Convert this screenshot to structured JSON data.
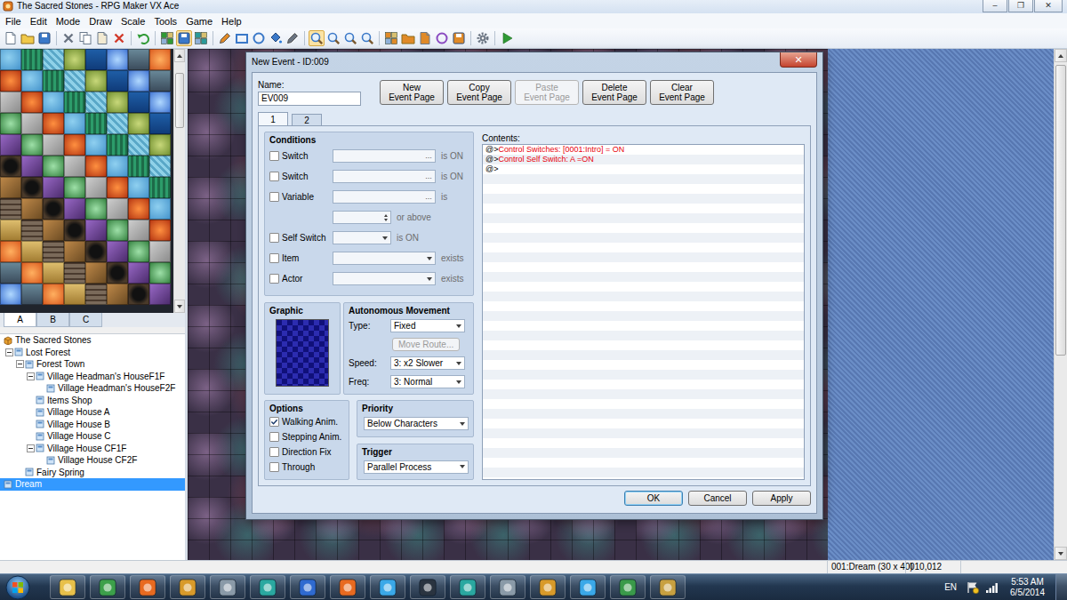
{
  "window": {
    "title": "The Sacred Stones - RPG Maker VX Ace",
    "controls": [
      "–",
      "❐",
      "✕"
    ]
  },
  "menu": [
    "File",
    "Edit",
    "Mode",
    "Draw",
    "Scale",
    "Tools",
    "Game",
    "Help"
  ],
  "toolbar": [
    [
      {
        "selected": false
      },
      {
        "selected": false
      },
      {
        "selected": false
      }
    ],
    [
      {
        "selected": false
      },
      {
        "selected": false
      },
      {
        "selected": false
      },
      {
        "selected": false
      }
    ],
    [
      {
        "selected": false
      }
    ],
    [
      {
        "selected": false
      },
      {
        "selected": true
      },
      {
        "selected": false
      }
    ],
    [
      {
        "selected": false
      },
      {
        "selected": false
      },
      {
        "selected": false
      },
      {
        "selected": false
      },
      {
        "selected": false
      }
    ],
    [
      {
        "selected": true
      },
      {
        "selected": false
      },
      {
        "selected": false
      },
      {
        "selected": false
      }
    ],
    [
      {
        "selected": false
      },
      {
        "selected": false
      },
      {
        "selected": false
      },
      {
        "selected": false
      },
      {
        "selected": false
      }
    ],
    [
      {
        "selected": false
      }
    ],
    [
      {
        "selected": false
      }
    ]
  ],
  "tileset": {
    "tabs": [
      {
        "label": "A",
        "selected": true
      },
      {
        "label": "B",
        "selected": false
      },
      {
        "label": "C",
        "selected": false
      }
    ]
  },
  "map_tree": [
    {
      "label": "The Sacred Stones",
      "level": 0,
      "kind": "project",
      "expanded": true,
      "selected": false
    },
    {
      "label": "Lost Forest",
      "level": 0,
      "kind": "branch",
      "expanded": true,
      "selected": false
    },
    {
      "label": "Forest Town",
      "level": 1,
      "kind": "branch",
      "expanded": true,
      "selected": false
    },
    {
      "label": "Village Headman's HouseF1F",
      "level": 2,
      "kind": "branch",
      "expanded": true,
      "selected": false
    },
    {
      "label": "Village Headman's HouseF2F",
      "level": 3,
      "kind": "leaf",
      "expanded": false,
      "selected": false
    },
    {
      "label": "Items Shop",
      "level": 2,
      "kind": "leaf",
      "expanded": false,
      "selected": false
    },
    {
      "label": "Village House A",
      "level": 2,
      "kind": "leaf",
      "expanded": false,
      "selected": false
    },
    {
      "label": "Village House B",
      "level": 2,
      "kind": "leaf",
      "expanded": false,
      "selected": false
    },
    {
      "label": "Village House C",
      "level": 2,
      "kind": "leaf",
      "expanded": false,
      "selected": false
    },
    {
      "label": "Village House CF1F",
      "level": 2,
      "kind": "branch",
      "expanded": true,
      "selected": false
    },
    {
      "label": "Village House CF2F",
      "level": 3,
      "kind": "leaf",
      "expanded": false,
      "selected": false
    },
    {
      "label": "Fairy Spring",
      "level": 1,
      "kind": "leaf",
      "expanded": false,
      "selected": false
    },
    {
      "label": "Dream",
      "level": 0,
      "kind": "leaf",
      "expanded": false,
      "selected": true
    }
  ],
  "dialog": {
    "title": "New Event - ID:009",
    "close": "✕",
    "name": {
      "label": "Name:",
      "value": "EV009"
    },
    "page_buttons": [
      {
        "lines": [
          "New",
          "Event Page"
        ],
        "disabled": false
      },
      {
        "lines": [
          "Copy",
          "Event Page"
        ],
        "disabled": false
      },
      {
        "lines": [
          "Paste",
          "Event Page"
        ],
        "disabled": true
      },
      {
        "lines": [
          "Delete",
          "Event Page"
        ],
        "disabled": false
      },
      {
        "lines": [
          "Clear",
          "Event Page"
        ],
        "disabled": false
      }
    ],
    "tabs": [
      {
        "label": "1",
        "selected": true
      },
      {
        "label": "2",
        "selected": false
      }
    ],
    "conditions": {
      "title": "Conditions",
      "rows": [
        {
          "kind": "field",
          "label": "Switch",
          "checked": false,
          "value": "",
          "button": "...",
          "suffix": "is ON",
          "disabled": true
        },
        {
          "kind": "field",
          "label": "Switch",
          "checked": false,
          "value": "",
          "button": "...",
          "suffix": "is ON",
          "disabled": true
        },
        {
          "kind": "field",
          "label": "Variable",
          "checked": false,
          "value": "",
          "button": "...",
          "suffix": "is",
          "disabled": true
        },
        {
          "kind": "spin",
          "label": "",
          "checked": false,
          "value": "",
          "button": "",
          "suffix": "or above",
          "disabled": true
        },
        {
          "kind": "short-dropdown",
          "label": "Self Switch",
          "checked": false,
          "value": "",
          "button": "",
          "suffix": "is ON",
          "disabled": true
        },
        {
          "kind": "dropdown",
          "label": "Item",
          "checked": false,
          "value": "",
          "button": "",
          "suffix": "exists",
          "disabled": true
        },
        {
          "kind": "dropdown",
          "label": "Actor",
          "checked": false,
          "value": "",
          "button": "",
          "suffix": "exists",
          "disabled": true
        }
      ]
    },
    "graphic": {
      "title": "Graphic"
    },
    "movement": {
      "title": "Autonomous Movement",
      "type": {
        "label": "Type:",
        "value": "Fixed"
      },
      "move_route": {
        "label": "Move Route...",
        "disabled": true
      },
      "speed": {
        "label": "Speed:",
        "value": "3: x2 Slower"
      },
      "freq": {
        "label": "Freq:",
        "value": "3: Normal"
      }
    },
    "options": {
      "title": "Options",
      "items": [
        {
          "label": "Walking Anim.",
          "checked": true
        },
        {
          "label": "Stepping Anim.",
          "checked": false
        },
        {
          "label": "Direction Fix",
          "checked": false
        },
        {
          "label": "Through",
          "checked": false
        }
      ]
    },
    "priority": {
      "title": "Priority",
      "value": "Below Characters"
    },
    "trigger": {
      "title": "Trigger",
      "value": "Parallel Process"
    },
    "contents": {
      "title": "Contents:",
      "lines": [
        {
          "marker": "@>",
          "text": "Control Switches: [0001:Intro] = ON",
          "color": "#e8000b"
        },
        {
          "marker": "@>",
          "text": "Control Self Switch: A =ON",
          "color": "#e8000b"
        },
        {
          "marker": "@>",
          "text": "",
          "color": "#000000"
        }
      ]
    },
    "buttons": [
      {
        "label": "OK",
        "default": true
      },
      {
        "label": "Cancel",
        "default": false
      },
      {
        "label": "Apply",
        "default": false
      }
    ]
  },
  "status_bar": {
    "map": "001:Dream (30 x 40)",
    "coords": "010,012"
  },
  "taskbar": {
    "language": "EN",
    "time": "5:53 AM",
    "date": "6/5/2014"
  }
}
